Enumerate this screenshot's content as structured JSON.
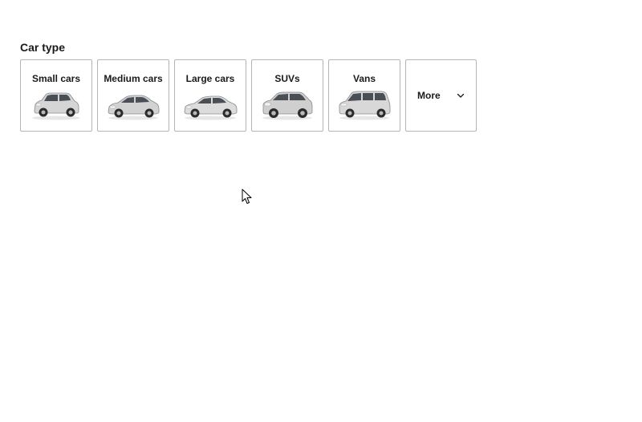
{
  "filter": {
    "title": "Car type",
    "options": [
      {
        "label": "Small cars",
        "icon": "small-car-icon"
      },
      {
        "label": "Medium cars",
        "icon": "medium-car-icon"
      },
      {
        "label": "Large cars",
        "icon": "large-car-icon"
      },
      {
        "label": "SUVs",
        "icon": "suv-icon"
      },
      {
        "label": "Vans",
        "icon": "van-icon"
      }
    ],
    "more_label": "More",
    "more_icon": "chevron-down-icon"
  },
  "cursor": {
    "icon": "mouse-pointer-icon"
  }
}
